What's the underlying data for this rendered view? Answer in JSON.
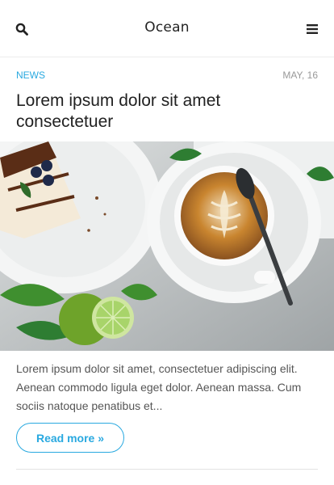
{
  "header": {
    "brand": "Ocean",
    "search_icon": "search-icon",
    "menu_icon": "hamburger-menu-icon"
  },
  "post": {
    "category": "NEWS",
    "date": "MAY, 16",
    "title": "Lorem ipsum dolor sit amet consectetuer",
    "image_alt": "cappuccino-and-cake-photo",
    "excerpt": "Lorem ipsum dolor sit amet, consectetuer adipiscing elit. Aenean commodo ligula eget dolor. Aenean massa. Cum sociis natoque penatibus et...",
    "read_more": "Read more »"
  },
  "colors": {
    "accent": "#29a9e0",
    "text": "#222222",
    "muted": "#999999"
  }
}
